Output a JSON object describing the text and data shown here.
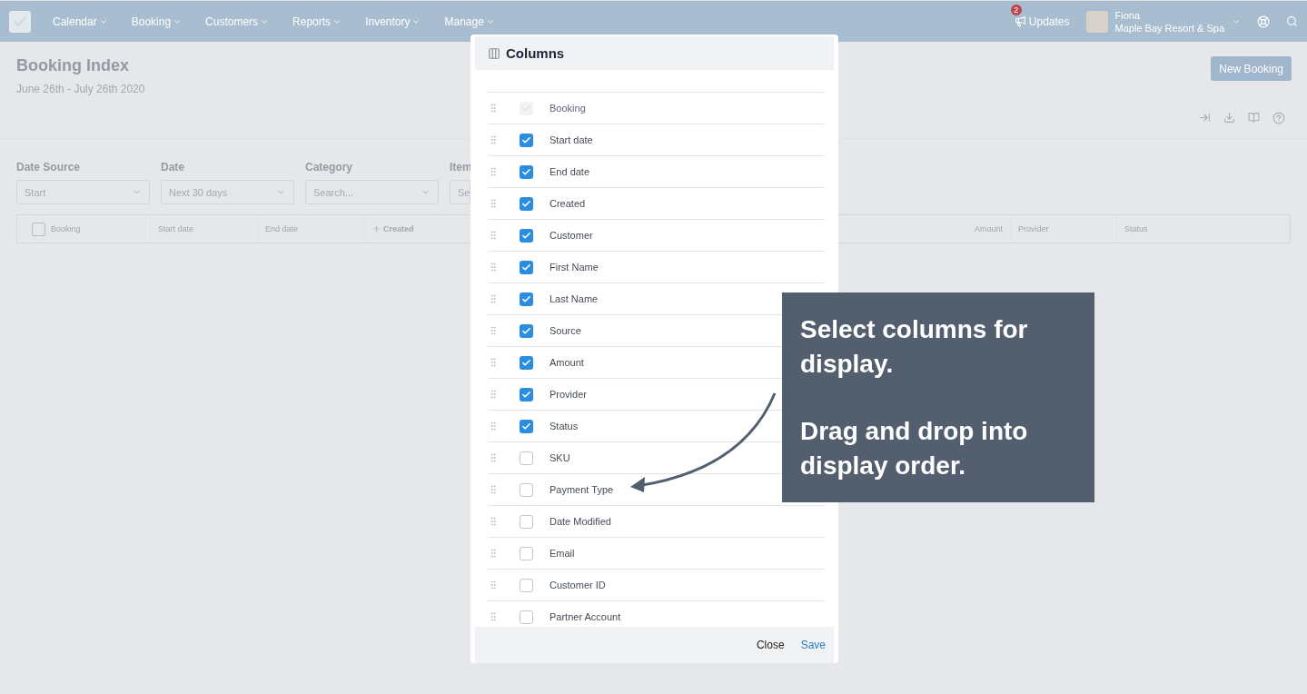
{
  "nav": {
    "items": [
      "Calendar",
      "Booking",
      "Customers",
      "Reports",
      "Inventory",
      "Manage"
    ],
    "updates": {
      "label": "Updates",
      "badge": "2"
    },
    "user": {
      "name": "Fiona",
      "property": "Maple Bay Resort & Spa"
    }
  },
  "header": {
    "title": "Booking Index",
    "subtitle": "June 26th - July 26th 2020",
    "button": "New Booking"
  },
  "filters": [
    {
      "label": "Date Source",
      "value": "Start"
    },
    {
      "label": "Date",
      "value": "Next 30 days"
    },
    {
      "label": "Category",
      "placeholder": "Search..."
    },
    {
      "label": "Item",
      "placeholder": "Se"
    }
  ],
  "table": {
    "select_all_checked": false,
    "columns": [
      {
        "label": "Booking",
        "sorted": false
      },
      {
        "label": "Start date",
        "sorted": false
      },
      {
        "label": "End date",
        "sorted": false
      },
      {
        "label": "Created",
        "sorted": true
      }
    ],
    "right_columns": [
      "Amount",
      "Provider",
      "Status"
    ]
  },
  "modal": {
    "title": "Columns",
    "rows": [
      {
        "label": "Booking",
        "checked": true,
        "disabled": true
      },
      {
        "label": "Start date",
        "checked": true,
        "disabled": false
      },
      {
        "label": "End date",
        "checked": true,
        "disabled": false
      },
      {
        "label": "Created",
        "checked": true,
        "disabled": false
      },
      {
        "label": "Customer",
        "checked": true,
        "disabled": false
      },
      {
        "label": "First Name",
        "checked": true,
        "disabled": false
      },
      {
        "label": "Last Name",
        "checked": true,
        "disabled": false
      },
      {
        "label": "Source",
        "checked": true,
        "disabled": false
      },
      {
        "label": "Amount",
        "checked": true,
        "disabled": false
      },
      {
        "label": "Provider",
        "checked": true,
        "disabled": false
      },
      {
        "label": "Status",
        "checked": true,
        "disabled": false
      },
      {
        "label": "SKU",
        "checked": false,
        "disabled": false
      },
      {
        "label": "Payment Type",
        "checked": false,
        "disabled": false
      },
      {
        "label": "Date Modified",
        "checked": false,
        "disabled": false
      },
      {
        "label": "Email",
        "checked": false,
        "disabled": false
      },
      {
        "label": "Customer ID",
        "checked": false,
        "disabled": false
      },
      {
        "label": "Partner Account",
        "checked": false,
        "disabled": false
      }
    ],
    "buttons": [
      "Close",
      "Save"
    ]
  },
  "callout": {
    "paragraphs": [
      "Select columns for display.",
      "Drag and drop into display order."
    ]
  }
}
